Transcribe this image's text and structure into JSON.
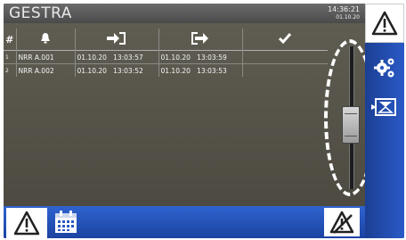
{
  "header": {
    "brand": "GESTRA",
    "time": "14:36:21",
    "date": "01.10.20"
  },
  "table": {
    "columns": [
      {
        "label": "#",
        "icon": "hash"
      },
      {
        "label": "",
        "icon": "bell-icon"
      },
      {
        "label": "",
        "icon": "arrow-in-icon"
      },
      {
        "label": "",
        "icon": "arrow-out-icon"
      },
      {
        "label": "",
        "icon": "checkmark-icon"
      }
    ],
    "rows": [
      {
        "num": "1",
        "name": "NRR A.001",
        "in_date": "01.10.20",
        "in_time": "13:03:57",
        "out_date": "01.10.20",
        "out_time": "13:03:59",
        "ack": ""
      },
      {
        "num": "2",
        "name": "NRR A.002",
        "in_date": "01.10.20",
        "in_time": "13:03:52",
        "out_date": "01.10.20",
        "out_time": "13:03:53",
        "ack": ""
      }
    ]
  },
  "sidebar": {
    "items": [
      {
        "name": "warning",
        "icon": "warning-icon"
      },
      {
        "name": "settings",
        "icon": "gears-icon"
      },
      {
        "name": "reset",
        "icon": "hourglass-reset-icon"
      }
    ]
  },
  "bottombar": {
    "items": [
      {
        "name": "alarm-list",
        "icon": "warning-icon"
      },
      {
        "name": "calendar",
        "icon": "calendar-icon"
      },
      {
        "name": "alarm-off",
        "icon": "crossed-warning-icon"
      }
    ]
  },
  "colors": {
    "accent": "#2a5ac6",
    "panel": "#55534a",
    "header": "#5a5a5a"
  }
}
